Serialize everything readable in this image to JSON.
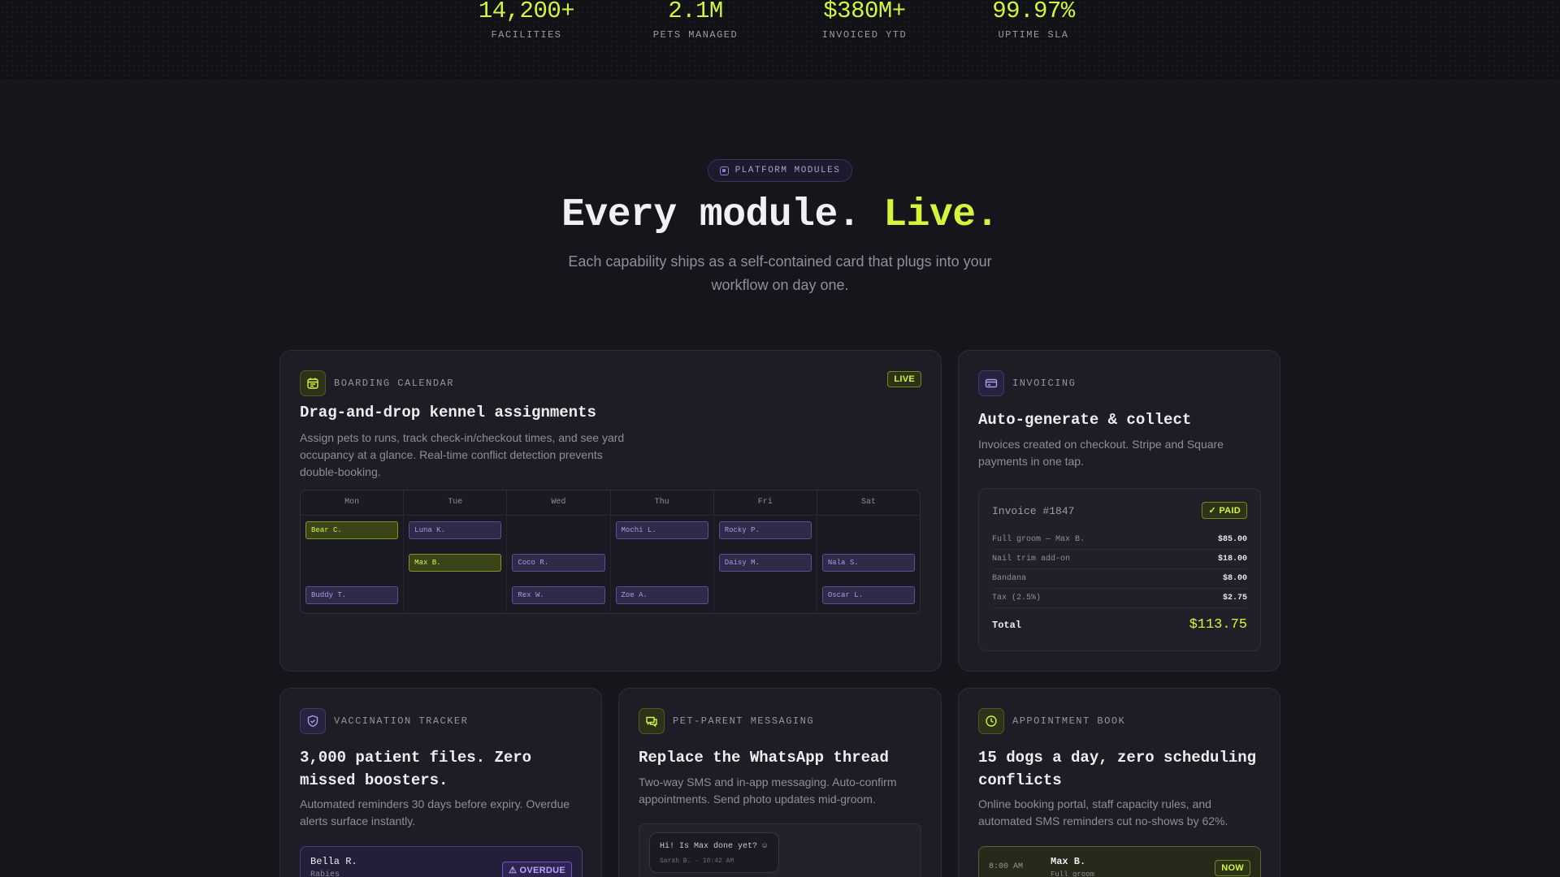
{
  "stats": [
    {
      "value": "14,200+",
      "label": "FACILITIES"
    },
    {
      "value": "2.1M",
      "label": "PETS MANAGED"
    },
    {
      "value": "$380M+",
      "label": "INVOICED YTD"
    },
    {
      "value": "99.97%",
      "label": "UPTIME SLA"
    }
  ],
  "hero": {
    "badge": "PLATFORM MODULES",
    "title_main": "Every module.",
    "title_accent": "Live.",
    "subtitle": "Each capability ships as a self-contained card that plugs into your workflow on day one."
  },
  "colors": {
    "accent": "#d4f53c",
    "purple": "#8b7fd6",
    "background": "#15161c"
  },
  "boarding": {
    "kicker": "BOARDING CALENDAR",
    "status": "LIVE",
    "title": "Drag-and-drop kennel assignments",
    "description": "Assign pets to runs, track check-in/checkout times, and see yard occupancy at a glance. Real-time conflict detection prevents double-booking.",
    "icon": "calendar-icon",
    "days": [
      "Mon",
      "Tue",
      "Wed",
      "Thu",
      "Fri",
      "Sat"
    ],
    "bookings": [
      {
        "name": "Bear C.",
        "day": 0,
        "row": 0,
        "highlight": true
      },
      {
        "name": "Buddy T.",
        "day": 0,
        "row": 2,
        "highlight": false
      },
      {
        "name": "Luna K.",
        "day": 1,
        "row": 0,
        "highlight": false
      },
      {
        "name": "Max B.",
        "day": 1,
        "row": 1,
        "highlight": true
      },
      {
        "name": "Coco R.",
        "day": 2,
        "row": 1,
        "highlight": false
      },
      {
        "name": "Rex W.",
        "day": 2,
        "row": 2,
        "highlight": false
      },
      {
        "name": "Mochi L.",
        "day": 3,
        "row": 0,
        "highlight": false
      },
      {
        "name": "Zoe A.",
        "day": 3,
        "row": 2,
        "highlight": false
      },
      {
        "name": "Rocky P.",
        "day": 4,
        "row": 0,
        "highlight": false
      },
      {
        "name": "Daisy M.",
        "day": 4,
        "row": 1,
        "highlight": false
      },
      {
        "name": "Nala S.",
        "day": 5,
        "row": 1,
        "highlight": false
      },
      {
        "name": "Oscar L.",
        "day": 5,
        "row": 2,
        "highlight": false
      }
    ]
  },
  "invoicing": {
    "kicker": "INVOICING",
    "title": "Auto-generate & collect",
    "description": "Invoices created on checkout. Stripe and Square payments in one tap.",
    "icon": "credit-card-icon",
    "invoice_number": "Invoice #1847",
    "status": "✓ PAID",
    "lines": [
      {
        "label": "Full groom — Max B.",
        "amount": "$85.00"
      },
      {
        "label": "Nail trim add-on",
        "amount": "$18.00"
      },
      {
        "label": "Bandana",
        "amount": "$8.00"
      },
      {
        "label": "Tax (2.5%)",
        "amount": "$2.75"
      }
    ],
    "total_label": "Total",
    "total_amount": "$113.75"
  },
  "vaccination": {
    "kicker": "VACCINATION TRACKER",
    "title": "3,000 patient files. Zero missed boosters.",
    "description": "Automated reminders 30 days before expiry. Overdue alerts surface instantly.",
    "icon": "shield-icon",
    "record_name": "Bella R.",
    "record_vaccine": "Rabies",
    "record_status": "⚠ OVERDUE"
  },
  "messaging": {
    "kicker": "PET-PARENT MESSAGING",
    "title": "Replace the WhatsApp thread",
    "description": "Two-way SMS and in-app messaging. Auto-confirm appointments. Send photo updates mid-groom.",
    "icon": "chat-icon",
    "message_text": "Hi! Is Max done yet? ☺",
    "message_meta": "Sarah B. · 10:42 AM"
  },
  "appointments": {
    "kicker": "APPOINTMENT BOOK",
    "title": "15 dogs a day, zero scheduling conflicts",
    "description": "Online booking portal, staff capacity rules, and automated SMS reminders cut no-shows by 62%.",
    "icon": "clock-icon",
    "time": "8:00 AM",
    "pet": "Max B.",
    "service": "Full groom",
    "status": "NOW"
  }
}
